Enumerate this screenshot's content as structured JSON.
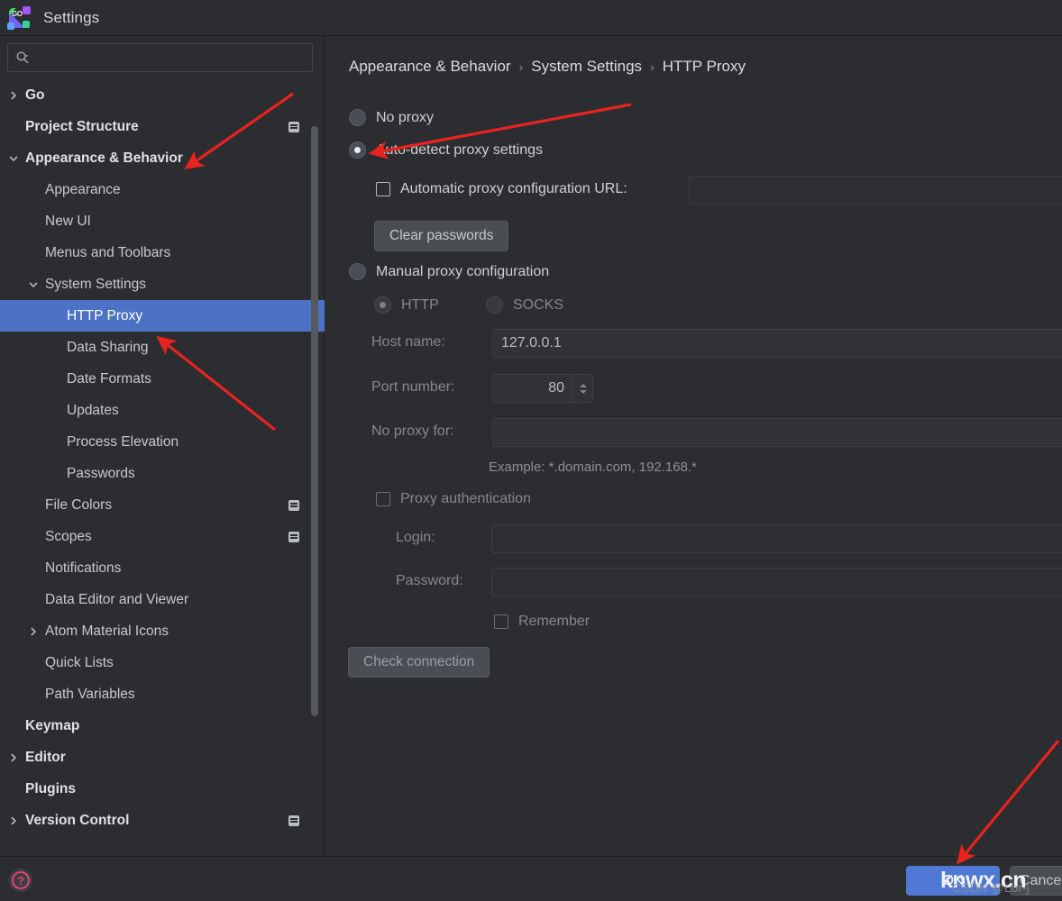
{
  "window": {
    "title": "Settings",
    "app_icon": "goland-icon"
  },
  "search": {
    "placeholder": "",
    "value": "",
    "icon": "search-icon"
  },
  "sidebar": {
    "items": [
      {
        "label": "Go",
        "indent": 0,
        "arrow": "right",
        "bold": true,
        "badge": false,
        "selected": false
      },
      {
        "label": "Project Structure",
        "indent": 0,
        "arrow": "",
        "bold": true,
        "badge": true,
        "selected": false
      },
      {
        "label": "Appearance & Behavior",
        "indent": 0,
        "arrow": "down",
        "bold": true,
        "badge": false,
        "selected": false
      },
      {
        "label": "Appearance",
        "indent": 1,
        "arrow": "",
        "bold": false,
        "badge": false,
        "selected": false
      },
      {
        "label": "New UI",
        "indent": 1,
        "arrow": "",
        "bold": false,
        "badge": false,
        "selected": false
      },
      {
        "label": "Menus and Toolbars",
        "indent": 1,
        "arrow": "",
        "bold": false,
        "badge": false,
        "selected": false
      },
      {
        "label": "System Settings",
        "indent": 1,
        "arrow": "down",
        "bold": false,
        "badge": false,
        "selected": false
      },
      {
        "label": "HTTP Proxy",
        "indent": 2,
        "arrow": "",
        "bold": false,
        "badge": false,
        "selected": true
      },
      {
        "label": "Data Sharing",
        "indent": 2,
        "arrow": "",
        "bold": false,
        "badge": false,
        "selected": false
      },
      {
        "label": "Date Formats",
        "indent": 2,
        "arrow": "",
        "bold": false,
        "badge": false,
        "selected": false
      },
      {
        "label": "Updates",
        "indent": 2,
        "arrow": "",
        "bold": false,
        "badge": false,
        "selected": false
      },
      {
        "label": "Process Elevation",
        "indent": 2,
        "arrow": "",
        "bold": false,
        "badge": false,
        "selected": false
      },
      {
        "label": "Passwords",
        "indent": 2,
        "arrow": "",
        "bold": false,
        "badge": false,
        "selected": false
      },
      {
        "label": "File Colors",
        "indent": 1,
        "arrow": "",
        "bold": false,
        "badge": true,
        "selected": false
      },
      {
        "label": "Scopes",
        "indent": 1,
        "arrow": "",
        "bold": false,
        "badge": true,
        "selected": false
      },
      {
        "label": "Notifications",
        "indent": 1,
        "arrow": "",
        "bold": false,
        "badge": false,
        "selected": false
      },
      {
        "label": "Data Editor and Viewer",
        "indent": 1,
        "arrow": "",
        "bold": false,
        "badge": false,
        "selected": false
      },
      {
        "label": "Atom Material Icons",
        "indent": 1,
        "arrow": "right",
        "bold": false,
        "badge": false,
        "selected": false
      },
      {
        "label": "Quick Lists",
        "indent": 1,
        "arrow": "",
        "bold": false,
        "badge": false,
        "selected": false
      },
      {
        "label": "Path Variables",
        "indent": 1,
        "arrow": "",
        "bold": false,
        "badge": false,
        "selected": false
      },
      {
        "label": "Keymap",
        "indent": 0,
        "arrow": "",
        "bold": true,
        "badge": false,
        "selected": false
      },
      {
        "label": "Editor",
        "indent": 0,
        "arrow": "right",
        "bold": true,
        "badge": false,
        "selected": false
      },
      {
        "label": "Plugins",
        "indent": 0,
        "arrow": "",
        "bold": true,
        "badge": false,
        "selected": false
      },
      {
        "label": "Version Control",
        "indent": 0,
        "arrow": "right",
        "bold": true,
        "badge": true,
        "selected": false
      }
    ]
  },
  "breadcrumb": {
    "part1": "Appearance & Behavior",
    "sep1": "›",
    "part2": "System Settings",
    "sep2": "›",
    "part3": "HTTP Proxy"
  },
  "proxy": {
    "no_proxy_label": "No proxy",
    "no_proxy_selected": false,
    "auto_detect_label": "Auto-detect proxy settings",
    "auto_detect_selected": true,
    "pac_checkbox_label": "Automatic proxy configuration URL:",
    "pac_checked": false,
    "pac_url_value": "",
    "clear_passwords_label": "Clear passwords",
    "manual_label": "Manual proxy configuration",
    "manual_selected": false,
    "http_label": "HTTP",
    "http_selected": true,
    "socks_label": "SOCKS",
    "socks_selected": false,
    "host_name_label": "Host name:",
    "host_name_value": "127.0.0.1",
    "port_number_label": "Port number:",
    "port_number_value": "80",
    "no_proxy_for_label": "No proxy for:",
    "no_proxy_for_value": "",
    "example_hint": "Example: *.domain.com, 192.168.*",
    "proxy_auth_label": "Proxy authentication",
    "proxy_auth_checked": false,
    "login_label": "Login:",
    "login_value": "",
    "password_label": "Password:",
    "password_value": "",
    "remember_label": "Remember",
    "remember_checked": false,
    "check_connection_label": "Check connection"
  },
  "footer": {
    "help_label": "?",
    "ok_label": "OK",
    "cancel_label": "Cancel"
  },
  "watermark": {
    "main": "knwx.cn",
    "sub": "CSDN @Lor-j"
  },
  "colors": {
    "selection": "#4c72c6",
    "primary_button": "#4f79d4",
    "annotation": "#e8231f",
    "help_accent": "#e0436f"
  }
}
